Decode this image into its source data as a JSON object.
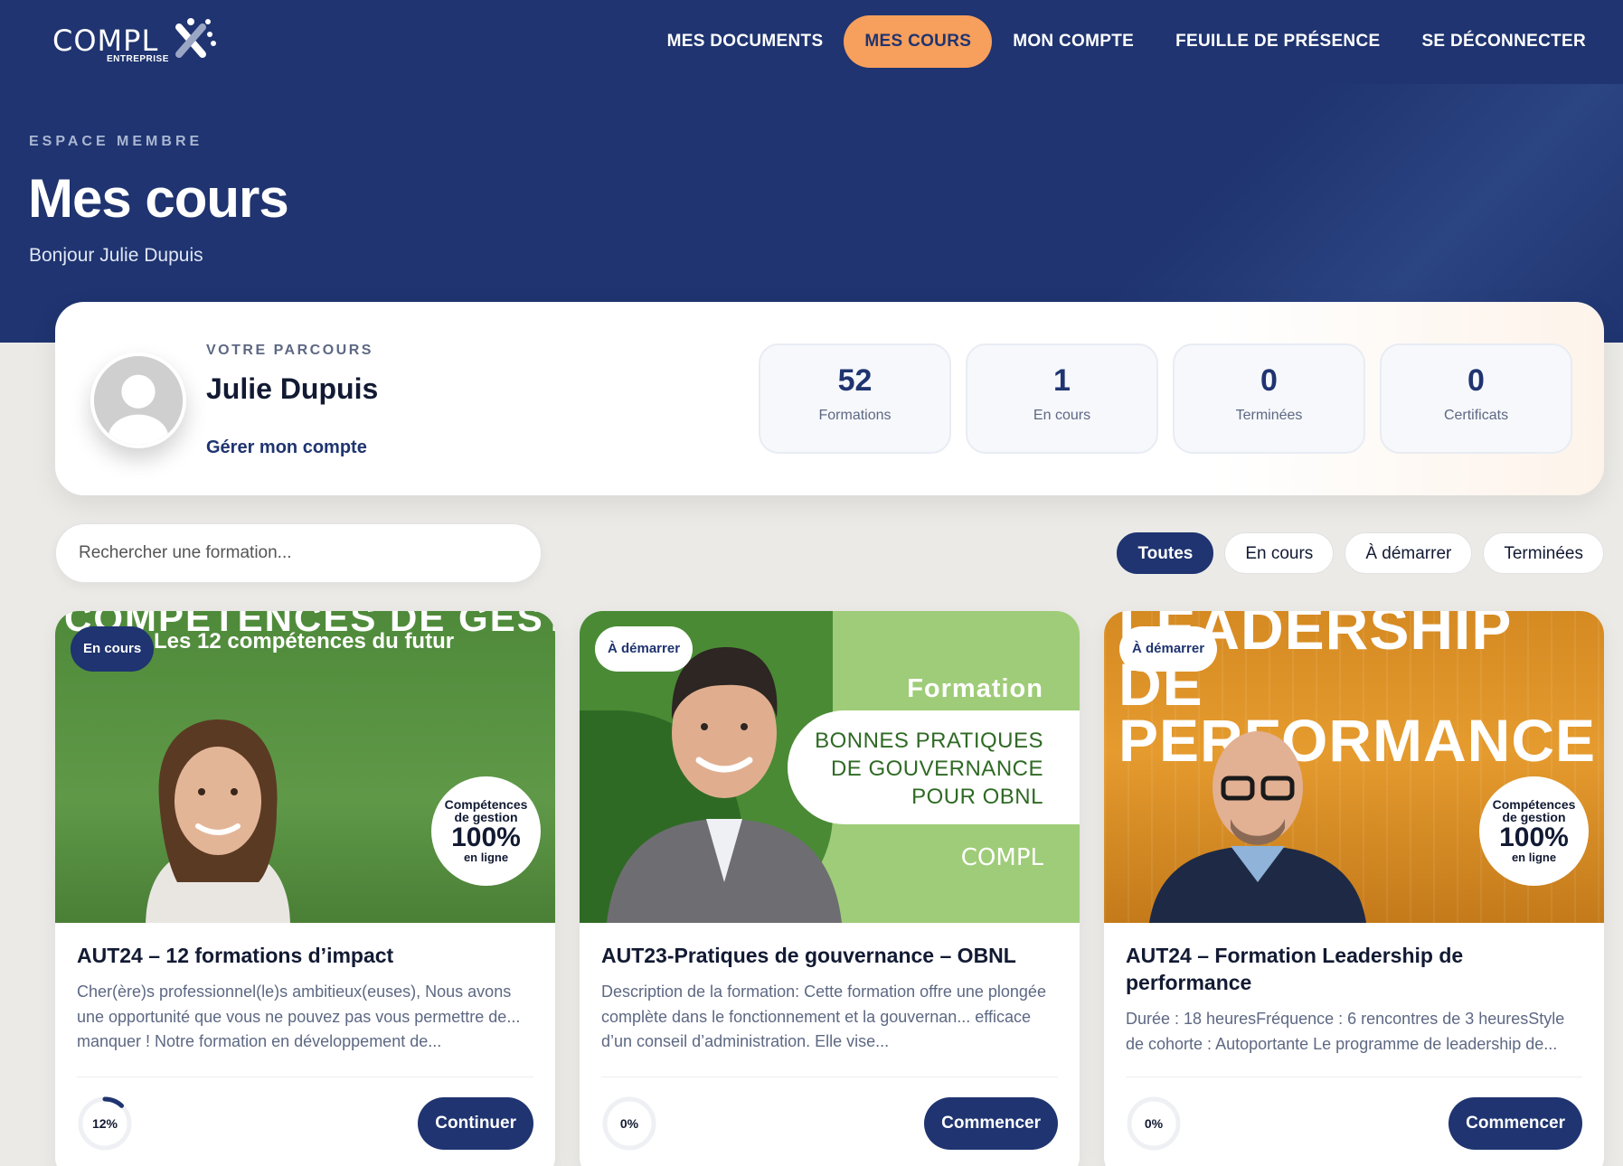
{
  "nav": {
    "logo_text": "COMPL",
    "logo_sub": "ENTREPRISE",
    "items": [
      {
        "label": "MES DOCUMENTS"
      },
      {
        "label": "MES COURS"
      },
      {
        "label": "MON COMPTE"
      },
      {
        "label": "FEUILLE DE PRÉSENCE"
      },
      {
        "label": "SE DÉCONNECTER"
      }
    ],
    "active_index": 1
  },
  "hero": {
    "eyebrow": "ESPACE MEMBRE",
    "title": "Mes cours",
    "greeting": "Bonjour Julie Dupuis"
  },
  "profile": {
    "label": "VOTRE PARCOURS",
    "name": "Julie Dupuis",
    "manage_link": "Gérer mon compte",
    "stats": [
      {
        "value": "52",
        "label": "Formations"
      },
      {
        "value": "1",
        "label": "En cours"
      },
      {
        "value": "0",
        "label": "Terminées"
      },
      {
        "value": "0",
        "label": "Certificats"
      }
    ]
  },
  "search": {
    "placeholder": "Rechercher une formation..."
  },
  "filters": [
    {
      "label": "Toutes"
    },
    {
      "label": "En cours"
    },
    {
      "label": "À démarrer"
    },
    {
      "label": "Terminées"
    }
  ],
  "courses": [
    {
      "status": "En cours",
      "image_heading": "COMPÉTENCES DE GESTION",
      "image_subheading": "Les 12 compétences du futur",
      "seal": {
        "line1": "Compétences",
        "line2": "de gestion",
        "line3": "100%",
        "line4": "en ligne"
      },
      "title": "AUT24 – 12 formations d’impact",
      "description": "Cher(ère)s professionnel(le)s ambitieux(euses), Nous avons une opportunité que vous ne pouvez pas vous permettre de... manquer ! Notre formation en développement de...",
      "progress_label": "12%",
      "progress": 0.12,
      "action": "Continuer"
    },
    {
      "status": "À démarrer",
      "image_heading": "Formation",
      "image_lines": [
        "BONNES PRATIQUES",
        "DE GOUVERNANCE",
        "POUR OBNL"
      ],
      "image_logo": "COMPL",
      "title": "AUT23-Pratiques de gouvernance – OBNL",
      "description": "Description de la formation: Cette formation offre une plongée complète dans le fonctionnement et la gouvernan... efficace d’un conseil d’administration. Elle vise...",
      "progress_label": "0%",
      "progress": 0,
      "action": "Commencer"
    },
    {
      "status": "À démarrer",
      "image_heading": "LEADERSHIP DE PERFORMANCE",
      "seal": {
        "line1": "Compétences",
        "line2": "de gestion",
        "line3": "100%",
        "line4": "en ligne"
      },
      "title": "AUT24 – Formation Leadership de performance",
      "description": "Durée : 18 heuresFréquence : 6 rencontres de 3 heuresStyle de cohorte : Autoportante Le programme de leadership de...",
      "progress_label": "0%",
      "progress": 0,
      "action": "Commencer"
    }
  ]
}
